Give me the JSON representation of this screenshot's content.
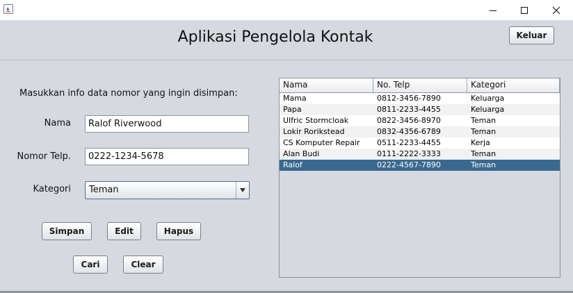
{
  "window": {
    "controls": {
      "minimize": "—",
      "maximize": "☐",
      "close": "✕"
    }
  },
  "header": {
    "title": "Aplikasi Pengelola Kontak",
    "exit_button": "Keluar"
  },
  "form": {
    "instruction": "Masukkan info data nomor yang ingin disimpan:",
    "name_label": "Nama",
    "name_value": "Ralof Riverwood",
    "phone_label": "Nomor Telp.",
    "phone_value": "0222-1234-5678",
    "category_label": "Kategori",
    "category_value": "Teman"
  },
  "buttons": {
    "save": "Simpan",
    "edit": "Edit",
    "delete": "Hapus",
    "search": "Cari",
    "clear": "Clear"
  },
  "table": {
    "columns": [
      "Nama",
      "No. Telp",
      "Kategori"
    ],
    "rows": [
      [
        "Mama",
        "0812-3456-7890",
        "Keluarga"
      ],
      [
        "Papa",
        "0811-2233-4455",
        "Keluarga"
      ],
      [
        "Ulfric Stormcloak",
        "0822-3456-8970",
        "Teman"
      ],
      [
        "Lokir Rorikstead",
        "0832-4356-6789",
        "Teman"
      ],
      [
        "CS Komputer Repair",
        "0511-2233-4455",
        "Kerja"
      ],
      [
        "Alan Budi",
        "0111-2222-3333",
        "Teman"
      ],
      [
        "Ralof",
        "0222-4567-7890",
        "Teman"
      ]
    ],
    "selected_row": 6
  }
}
